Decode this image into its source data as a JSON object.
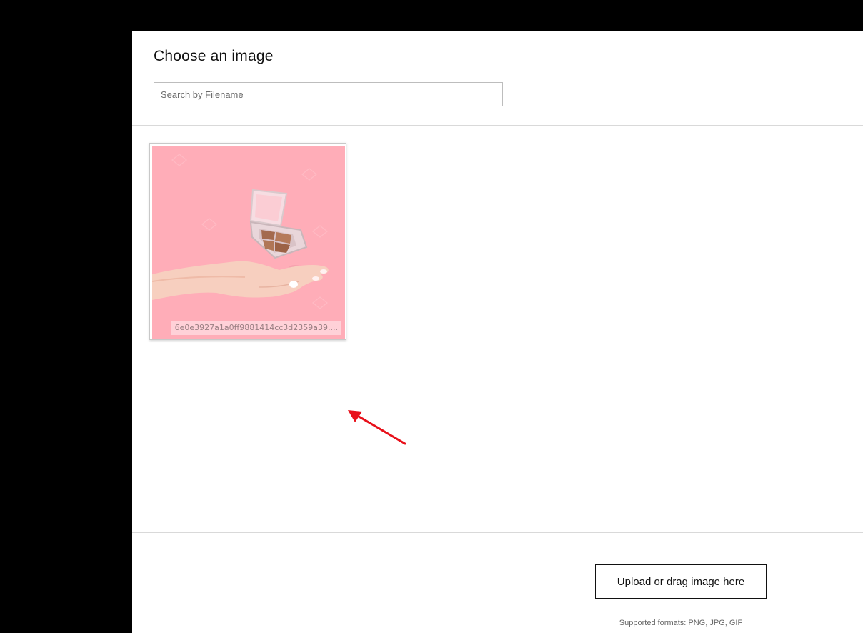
{
  "dialog": {
    "title": "Choose an image"
  },
  "search": {
    "placeholder": "Search by Filename",
    "value": ""
  },
  "gallery": {
    "images": [
      {
        "filename": "6e0e3927a1a0ff9881414cc3d2359a39....",
        "description_icon": "image-thumbnail",
        "background_color": "#ffadb8"
      }
    ]
  },
  "footer": {
    "upload_label": "Upload or drag image here",
    "supported_formats": "Supported formats: PNG, JPG, GIF"
  },
  "annotation": {
    "arrow_color": "#e8101a"
  }
}
